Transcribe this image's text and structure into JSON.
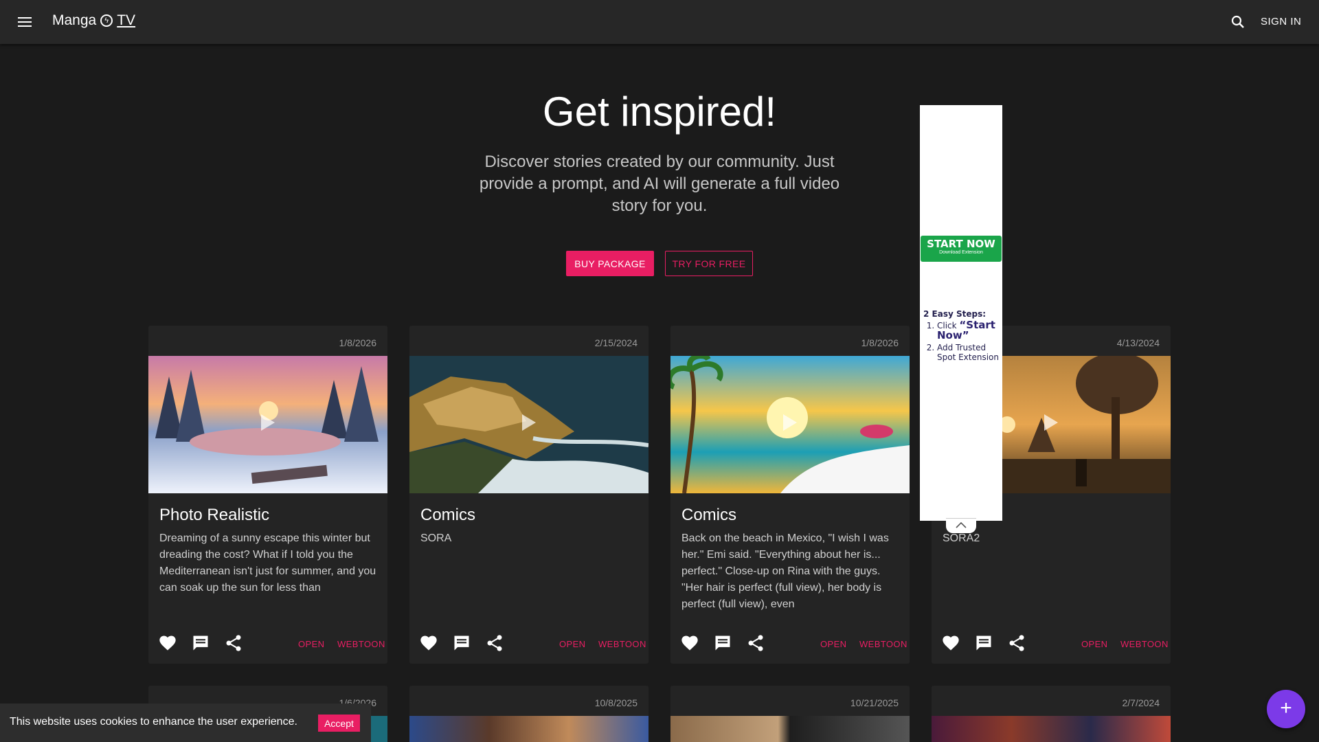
{
  "header": {
    "logo_text": "Manga",
    "logo_suffix": "TV",
    "signin_label": "SIGN IN"
  },
  "hero": {
    "title": "Get inspired!",
    "subtitle": "Discover stories created by our community. Just provide a prompt, and AI will generate a full video story for you.",
    "buy_label": "BUY PACKAGE",
    "try_label": "TRY FOR FREE"
  },
  "cards": [
    {
      "date": "1/8/2026",
      "title": "Photo Realistic",
      "desc": "Dreaming of a sunny escape this winter but dreading the cost? What if I told you the Mediterranean isn't just for summer, and you can soak up the sun for less than",
      "open": "OPEN",
      "webtoon": "WEBTOON"
    },
    {
      "date": "2/15/2024",
      "title": "Comics",
      "desc": "SORA",
      "open": "OPEN",
      "webtoon": "WEBTOON"
    },
    {
      "date": "1/8/2026",
      "title": "Comics",
      "desc": "Back on the beach in Mexico, \"I wish I was her.\" Emi said. \"Everything about her is... perfect.\" Close-up on Rina with the guys. \"Her hair is perfect (full view), her body is perfect (full view), even",
      "open": "OPEN",
      "webtoon": "WEBTOON"
    },
    {
      "date": "4/13/2024",
      "title": "",
      "desc": "SORA2",
      "open": "OPEN",
      "webtoon": "WEBTOON"
    }
  ],
  "cards_row2": [
    {
      "date": "1/6/2026"
    },
    {
      "date": "10/8/2025"
    },
    {
      "date": "10/21/2025"
    },
    {
      "date": "2/7/2024"
    }
  ],
  "ad": {
    "start_label": "START NOW",
    "start_sub": "Download Extension",
    "steps_heading": "2 Easy Steps:",
    "step1_prefix": "Click ",
    "step1_em": "“Start Now”",
    "step2": "Add Trusted Spot Extension"
  },
  "cookie": {
    "text": "This website uses cookies to enhance the user experience.",
    "accept_label": "Accept"
  },
  "fab": {
    "label": "+"
  },
  "colors": {
    "accent": "#e91e63",
    "fab": "#7c3ae8",
    "background": "#1b1b1b",
    "card": "#242424"
  }
}
